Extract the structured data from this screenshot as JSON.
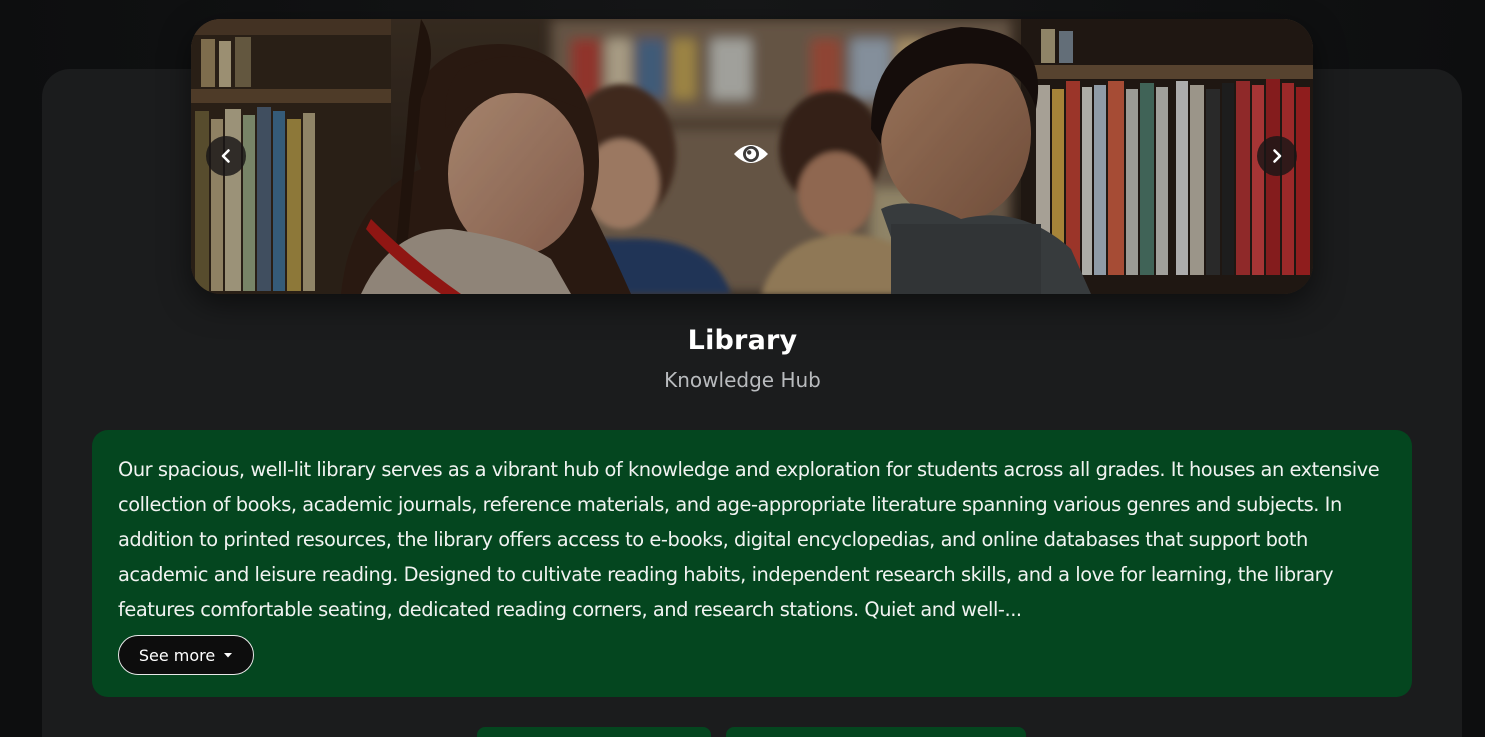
{
  "section": {
    "title": "Library",
    "subtitle": "Knowledge Hub",
    "description": "Our spacious, well-lit library serves as a vibrant hub of knowledge and exploration for students across all grades. It houses an extensive collection of books, academic journals, reference materials, and age-appropriate literature spanning various genres and subjects. In addition to printed resources, the library offers access to e-books, digital encyclopedias, and online databases that support both academic and leisure reading. Designed to cultivate reading habits, independent research skills, and a love for learning, the library features comfortable seating, dedicated reading corners, and research stations. Quiet and well-...",
    "see_more_label": "See more"
  },
  "carousel": {
    "image_alt": "Students reading in library",
    "prev_icon": "chevron-left-icon",
    "next_icon": "chevron-right-icon",
    "view_icon": "eye-icon"
  },
  "colors": {
    "background": "#0f1011",
    "card": "#1b1c1d",
    "description_bg": "#04461f",
    "title": "#ffffff",
    "subtitle": "#b9bbbe",
    "button_border": "#e8e8e8"
  }
}
